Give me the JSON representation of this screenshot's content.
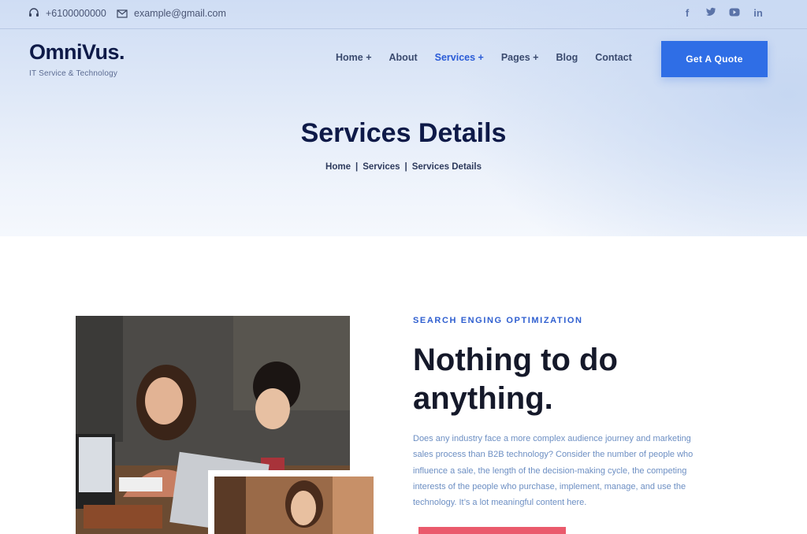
{
  "topbar": {
    "phone": "+6100000000",
    "email": "example@gmail.com",
    "social": [
      "f",
      "t",
      "yt",
      "in"
    ]
  },
  "logo": {
    "name": "OmniVus.",
    "tagline": "IT Service & Technology"
  },
  "nav": {
    "items": [
      "Home +",
      "About",
      "Services +",
      "Pages +",
      "Blog",
      "Contact"
    ],
    "active_index": 2
  },
  "cta": {
    "label": "Get A Quote"
  },
  "hero": {
    "title": "Services Details",
    "breadcrumb": [
      "Home",
      "Services",
      "Services Details"
    ],
    "sep": "|"
  },
  "content": {
    "kicker": "SEARCH ENGING OPTIMIZATION",
    "headline": "Nothing to do anything.",
    "paragraph": "Does any industry face a more complex audience journey and marketing sales process than B2B technology? Consider the number of people who influence a sale, the length of the decision-making cycle, the competing interests of the people who purchase, implement, manage, and use the technology. It’s a lot meaningful content here."
  },
  "colors": {
    "accent": "#2f6ee6",
    "kicker": "#2f5fd0",
    "cta_red": "#ea5a6c",
    "navy": "#0e1a48"
  }
}
